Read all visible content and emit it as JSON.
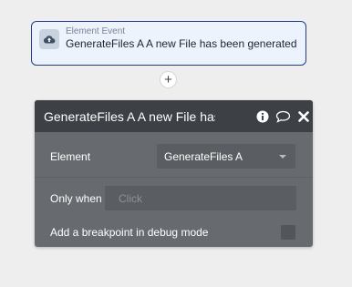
{
  "event": {
    "kicker": "Element Event",
    "name": "GenerateFiles A A new File has been generated",
    "icon": "cloud-upload-icon"
  },
  "add_action": {
    "label": "+",
    "icon": "plus-icon"
  },
  "panel": {
    "title": "GenerateFiles A A new File has b",
    "header_icons": [
      "info-icon",
      "comment-icon",
      "close-icon"
    ],
    "element_label": "Element",
    "element_value": "GenerateFiles A",
    "only_when_label": "Only when",
    "only_when_placeholder": "Click",
    "only_when_value": "",
    "debug_label": "Add a breakpoint in debug mode",
    "debug_checked": false
  },
  "colors": {
    "page_background": "#eeeeee",
    "event_card_background": "#edf3fd",
    "event_card_border": "#1f3d8c",
    "panel_header": "#3d4045",
    "panel_body": "#676a6f",
    "field_background": "#5a5d62"
  }
}
